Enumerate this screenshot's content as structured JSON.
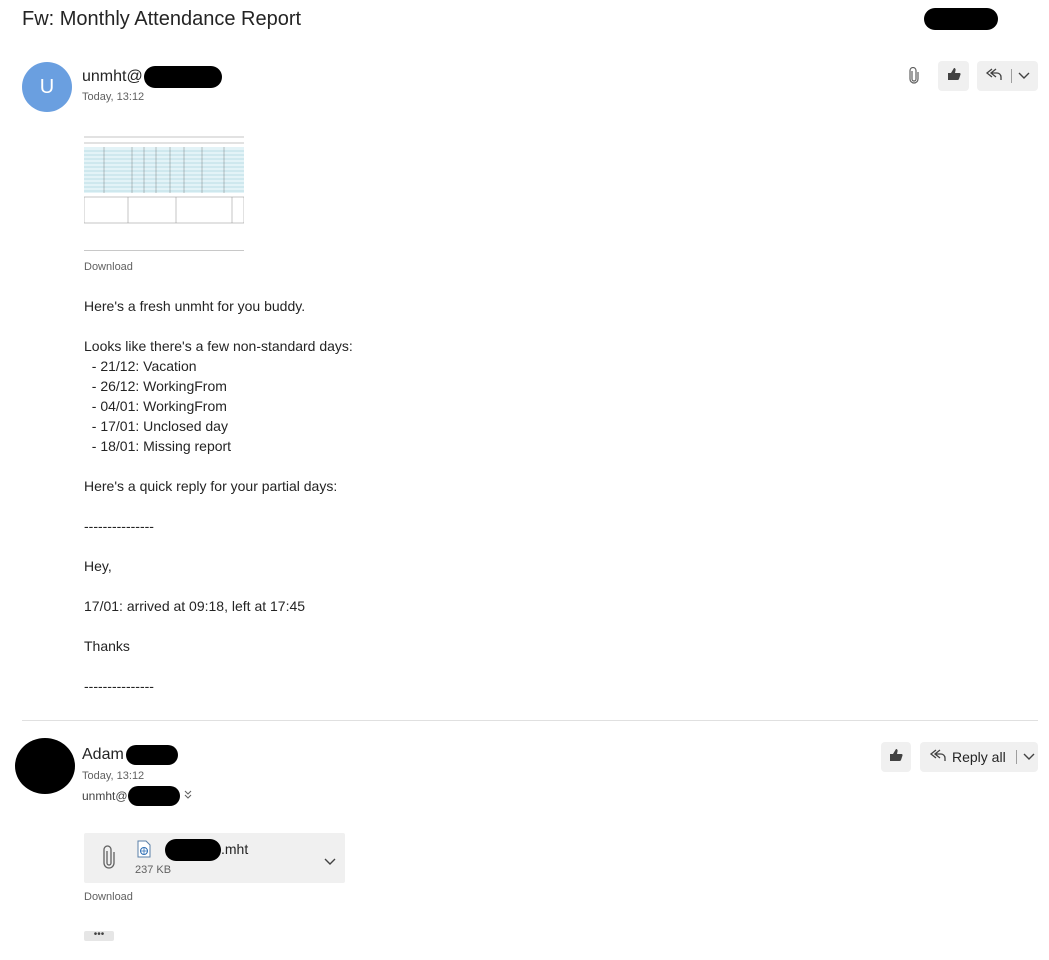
{
  "subject": "Fw: Monthly Attendance Report",
  "message1": {
    "avatar_initial": "U",
    "sender_prefix": "unmht@",
    "time": "Today, 13:12",
    "download_label": "Download",
    "body_lines": [
      "Here's a fresh unmht for you buddy.",
      "",
      "Looks like there's a few non-standard days:",
      "  - 21/12: Vacation",
      "  - 26/12: WorkingFrom",
      "  - 04/01: WorkingFrom",
      "  - 17/01: Unclosed day",
      "  - 18/01: Missing report",
      "",
      "Here's a quick reply for your partial days:",
      "",
      "---------------",
      "",
      "Hey,",
      "",
      "17/01: arrived at 09:18, left at 17:45",
      "",
      "Thanks",
      "",
      "---------------"
    ]
  },
  "message2": {
    "sender_name": "Adam",
    "time": "Today, 13:12",
    "to_prefix": "unmht@",
    "reply_all_label": "Reply all",
    "attachment": {
      "name_suffix": ".mht",
      "size": "237 KB"
    },
    "download_label": "Download",
    "more_label": "•••"
  },
  "icons": {
    "attachment": "paperclip-icon",
    "like": "thumbs-up-icon",
    "reply_all": "reply-all-icon",
    "chevron": "chevron-down-icon",
    "file": "file-web-icon"
  }
}
